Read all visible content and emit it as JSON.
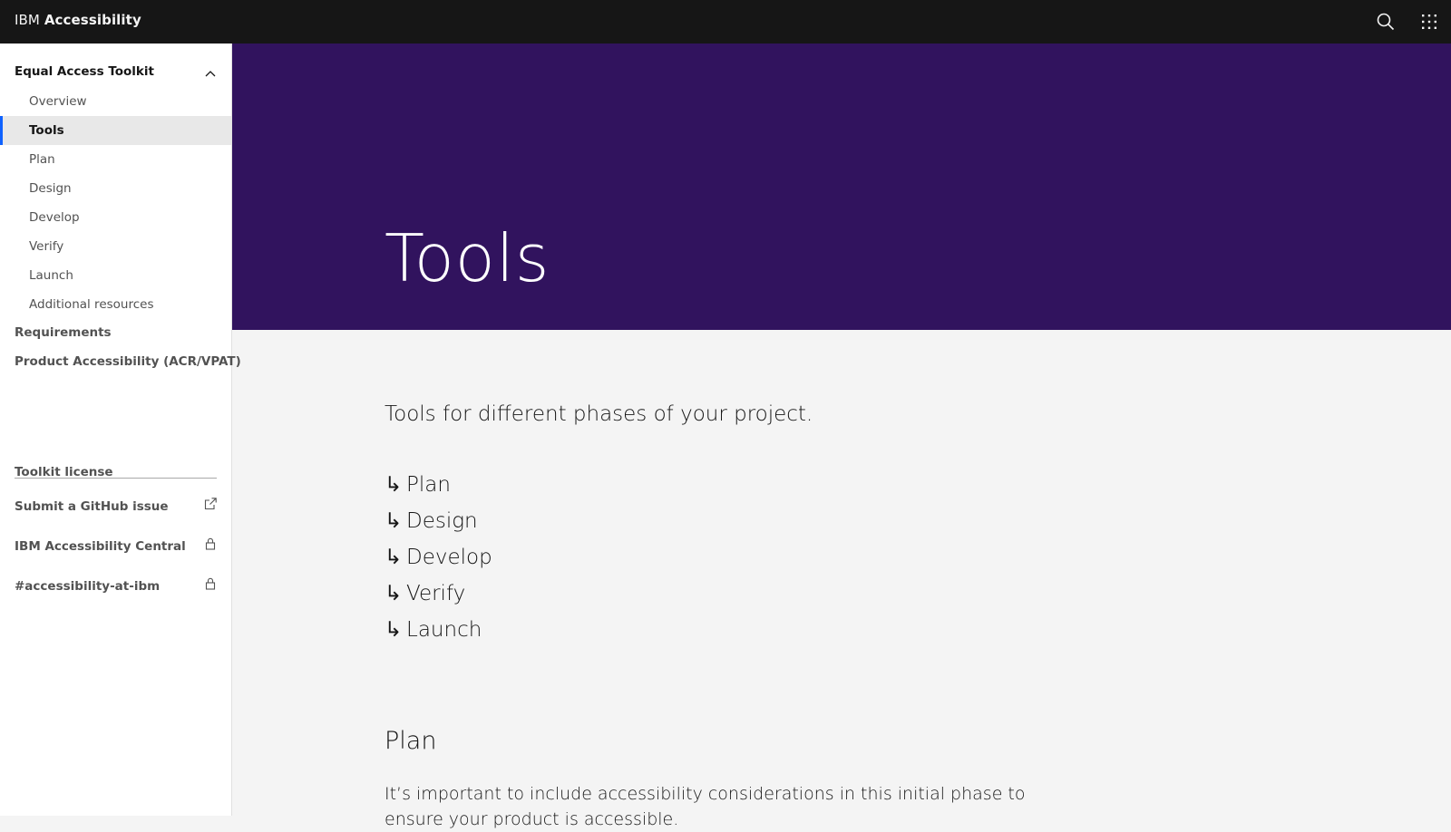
{
  "header": {
    "brand_prefix": "IBM",
    "brand_name": "Accessibility",
    "search_icon": "search-icon",
    "apps_icon": "app-switcher-icon"
  },
  "sidebar": {
    "section_title": "Equal Access Toolkit",
    "items": [
      {
        "label": "Overview"
      },
      {
        "label": "Tools",
        "active": true
      },
      {
        "label": "Plan"
      },
      {
        "label": "Design"
      },
      {
        "label": "Develop"
      },
      {
        "label": "Verify"
      },
      {
        "label": "Launch"
      },
      {
        "label": "Additional resources"
      }
    ],
    "sections": [
      {
        "label": "Requirements"
      },
      {
        "label": "Product Accessibility (ACR/VPAT)"
      }
    ],
    "resources": [
      {
        "label": "Toolkit license",
        "icon": ""
      },
      {
        "label": "Submit a GitHub issue",
        "icon": "external-link-icon"
      },
      {
        "label": "IBM Accessibility Central",
        "icon": "lock-icon"
      },
      {
        "label": "#accessibility-at-ibm",
        "icon": "lock-icon"
      }
    ],
    "accent_color": "#0f62fe"
  },
  "hero": {
    "title": "Tools",
    "background": "#31135e"
  },
  "main": {
    "intro": "Tools for different phases of your project.",
    "jump_links": [
      {
        "arrow": "↳",
        "label": "Plan"
      },
      {
        "arrow": "↳",
        "label": "Design"
      },
      {
        "arrow": "↳",
        "label": "Develop"
      },
      {
        "arrow": "↳",
        "label": "Verify"
      },
      {
        "arrow": "↳",
        "label": "Launch"
      }
    ],
    "section_title": "Plan",
    "section_body": "It’s important to include accessibility considerations in this initial phase to ensure your product is accessible."
  }
}
